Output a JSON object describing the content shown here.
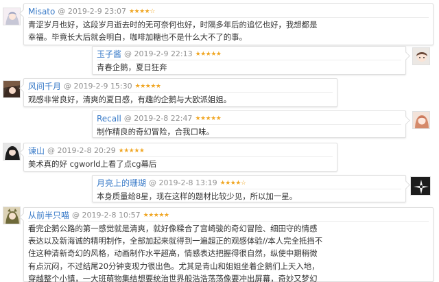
{
  "comments": [
    {
      "username": "Misato",
      "date": "@ 2019-2-9 23:07",
      "rating": 4,
      "rating_text": "★★★★☆",
      "lines": [
        "青涩岁月也好，这段岁月逝去时的无可奈何也好，时隔多年后的追忆也好，我想都是",
        "幸福。毕竟长大后就会明白，咖啡加糖也不是什么大不了的事。"
      ]
    },
    {
      "username": "玉子酱",
      "date": "@ 2019-2-9 22:13",
      "rating": 5,
      "rating_text": "★★★★★",
      "lines": [
        "青春企鹅，夏日狂奔"
      ]
    },
    {
      "username": "风间千月",
      "date": "@ 2019-2-9 15:30",
      "rating": 5,
      "rating_text": "★★★★★",
      "lines": [
        "观感非常良好，清爽的夏日感，有趣的企鹅与大欧派姐姐。"
      ]
    },
    {
      "username": "Recall",
      "date": "@ 2019-2-8 22:47",
      "rating": 5,
      "rating_text": "★★★★★",
      "lines": [
        "制作精良的奇幻冒险，合我口味。"
      ]
    },
    {
      "username": "谏山",
      "date": "@ 2019-2-8 20:29",
      "rating": 5,
      "rating_text": "★★★★★",
      "lines": [
        "美术真的好 cgworld上看了点cg幕后"
      ]
    },
    {
      "username": "月亮上的珊瑚",
      "date": "@ 2019-2-8 13:19",
      "rating": 4,
      "rating_text": "★★★★☆",
      "lines": [
        "本身质量给8星，现在这样的题材比较少见，所以加一星。"
      ]
    },
    {
      "username": "从前半只喵",
      "date": "@ 2019-2-8 10:57",
      "rating": 5,
      "rating_text": "★★★★★",
      "lines": [
        "看完企鹅公路的第一感觉就是清爽，就好像糅合了宫崎骏的奇幻冒险、细田守的情感",
        "表达以及新海诚的精明制作，全部加起来就得到一遍超正的观感体验//本人完全抵挡不",
        "住这种清新奇幻的风格，动画制作水平超高，情感表达把握得很自然，纵使中期稍微",
        "有点沉闷，不过结尾20分钟变现力很出色。尤其是青山和姐姐坐着企鹅们上天入地，",
        "穿越整个小镇，一大班萌物集结想要统治世界般浩浩荡荡像要冲出屏幕，奇妙又梦幻"
      ]
    }
  ]
}
